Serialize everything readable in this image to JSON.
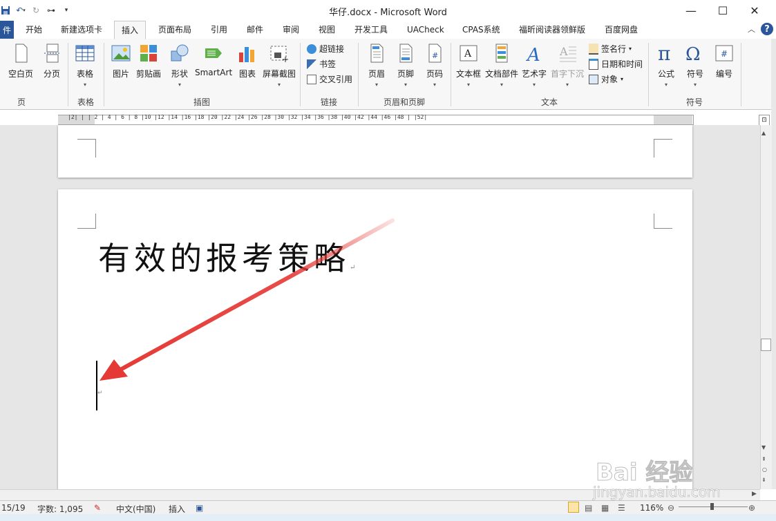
{
  "window": {
    "title": "华仔.docx  -  Microsoft Word",
    "minimize_icon": "—",
    "maximize_icon": "☐",
    "close_icon": "✕"
  },
  "quick_access": [
    "save-icon",
    "undo-icon",
    "redo-icon",
    "tree-icon",
    "customize-icon"
  ],
  "tabs": {
    "file": "件",
    "items": [
      {
        "label": "开始"
      },
      {
        "label": "新建选项卡"
      },
      {
        "label": "插入",
        "active": true
      },
      {
        "label": "页面布局"
      },
      {
        "label": "引用"
      },
      {
        "label": "邮件"
      },
      {
        "label": "审阅"
      },
      {
        "label": "视图"
      },
      {
        "label": "开发工具"
      },
      {
        "label": "UACheck"
      },
      {
        "label": "CPAS系统"
      },
      {
        "label": "福昕阅读器领鲜版"
      },
      {
        "label": "百度网盘"
      }
    ]
  },
  "ribbon": {
    "groups": {
      "pages": "页",
      "tables": "表格",
      "illustrations": "插图",
      "links": "链接",
      "header_footer": "页眉和页脚",
      "text": "文本",
      "symbols": "符号"
    },
    "buttons": {
      "blank_page": "空白页",
      "page_break": "分页",
      "table": "表格",
      "picture": "图片",
      "clip_art": "剪贴画",
      "shapes": "形状",
      "smartart": "SmartArt",
      "chart": "图表",
      "screenshot": "屏幕截图",
      "hyperlink": "超链接",
      "bookmark": "书签",
      "cross_reference": "交叉引用",
      "header": "页眉",
      "footer": "页脚",
      "page_number": "页码",
      "text_box": "文本框",
      "quick_parts": "文档部件",
      "wordart": "艺术字",
      "drop_cap": "首字下沉",
      "signature_line": "签名行",
      "date_time": "日期和时间",
      "object": "对象",
      "equation": "公式",
      "symbol": "符号",
      "numbering": "编号"
    }
  },
  "ruler": {
    "ticks": "|2| |  | 2 | 4 | 6 | 8 |10 |12 |14 |16 |18 |20 |22 |24 |26 |28 |30 |32 |34 |36 |38 |40 |42 |44 |46 |48 | |52|"
  },
  "document": {
    "heading": "有效的报考策略",
    "para_mark": "↵"
  },
  "statusbar": {
    "page": "15/19",
    "word_count": "字数: 1,095",
    "language": "中文(中国)",
    "mode": "插入",
    "zoom": "116%"
  },
  "watermark": {
    "brand": "Bai 经验",
    "url": "jingyan.baidu.com"
  },
  "colors": {
    "accent": "#2b579a",
    "arrow": "#e53935"
  }
}
